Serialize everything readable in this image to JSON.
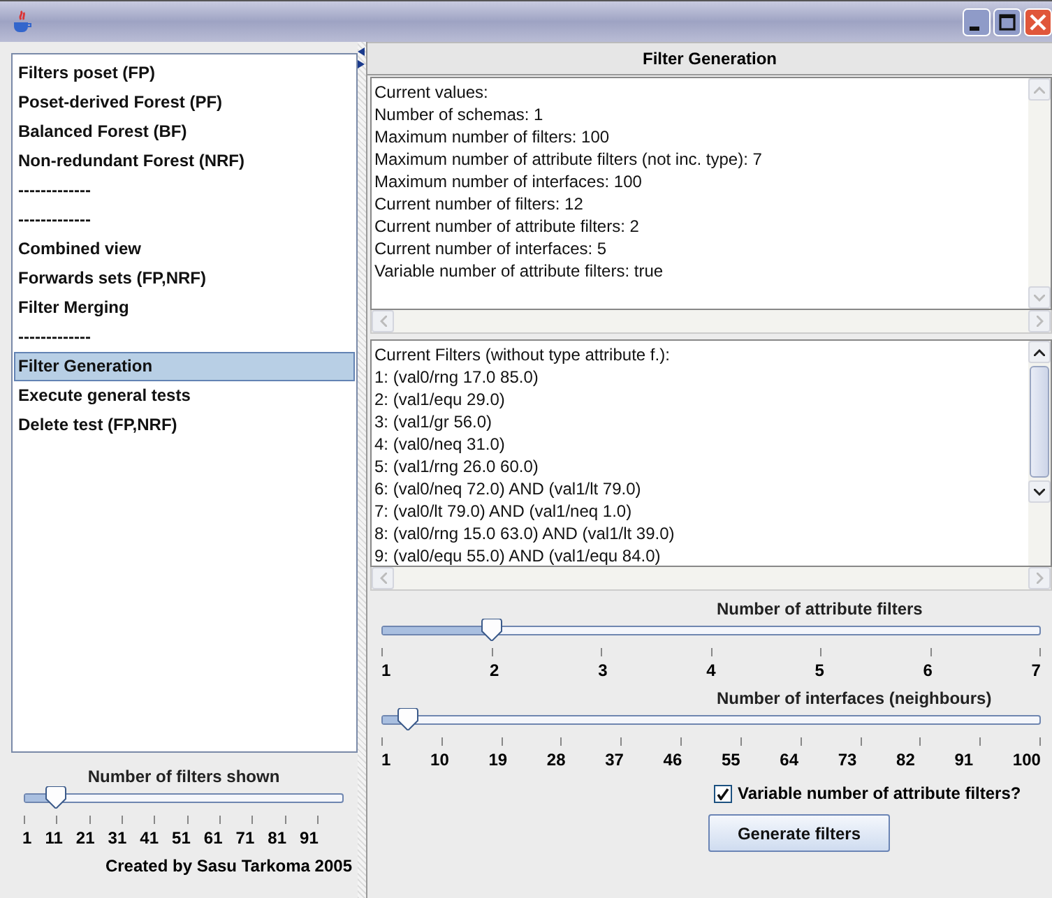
{
  "sidebar": {
    "items": [
      {
        "label": "Filters poset (FP)",
        "selected": false
      },
      {
        "label": "Poset-derived Forest (PF)",
        "selected": false
      },
      {
        "label": "Balanced Forest (BF)",
        "selected": false
      },
      {
        "label": "Non-redundant Forest (NRF)",
        "selected": false
      },
      {
        "label": "-------------",
        "selected": false
      },
      {
        "label": "-------------",
        "selected": false
      },
      {
        "label": "Combined view",
        "selected": false
      },
      {
        "label": "Forwards sets (FP,NRF)",
        "selected": false
      },
      {
        "label": "Filter Merging",
        "selected": false
      },
      {
        "label": "-------------",
        "selected": false
      },
      {
        "label": "Filter Generation",
        "selected": true
      },
      {
        "label": "Execute general tests",
        "selected": false
      },
      {
        "label": "Delete test (FP,NRF)",
        "selected": false
      }
    ],
    "slider": {
      "label": "Number of filters shown",
      "level": 0.1,
      "ticks": [
        "1",
        "11",
        "21",
        "31",
        "41",
        "51",
        "61",
        "71",
        "81",
        "91"
      ]
    },
    "credit": "Created by Sasu Tarkoma 2005"
  },
  "panel": {
    "title": "Filter Generation",
    "values_text": [
      "Current values:",
      "Number of schemas: 1",
      "Maximum number of filters: 100",
      "Maximum number of attribute filters (not inc. type): 7",
      "Maximum number of interfaces: 100",
      "Current number of filters: 12",
      "Current number of attribute filters: 2",
      "Current number of interfaces: 5",
      "Variable number of attribute filters: true"
    ],
    "filters_text": [
      "Current Filters (without type attribute f.):",
      "1: (val0/rng 17.0 85.0)",
      "2: (val1/equ 29.0)",
      "3: (val1/gr 56.0)",
      "4: (val0/neq 31.0)",
      "5: (val1/rng 26.0 60.0)",
      "6: (val0/neq 72.0) AND (val1/lt 79.0)",
      "7: (val0/lt 79.0) AND (val1/neq 1.0)",
      "8: (val0/rng 15.0 63.0) AND (val1/lt 39.0)",
      "9: (val0/equ 55.0) AND (val1/equ 84.0)"
    ],
    "sliders": [
      {
        "label": "Number of attribute filters",
        "level": 0.167,
        "ticks": [
          "1",
          "2",
          "3",
          "4",
          "5",
          "6",
          "7"
        ]
      },
      {
        "label": "Number of interfaces (neighbours)",
        "level": 0.04,
        "ticks": [
          "1",
          "10",
          "19",
          "28",
          "37",
          "46",
          "55",
          "64",
          "73",
          "82",
          "91",
          "100"
        ]
      }
    ],
    "checkbox": {
      "label": "Variable number of attribute filters?",
      "checked": true
    },
    "button": "Generate filters"
  }
}
